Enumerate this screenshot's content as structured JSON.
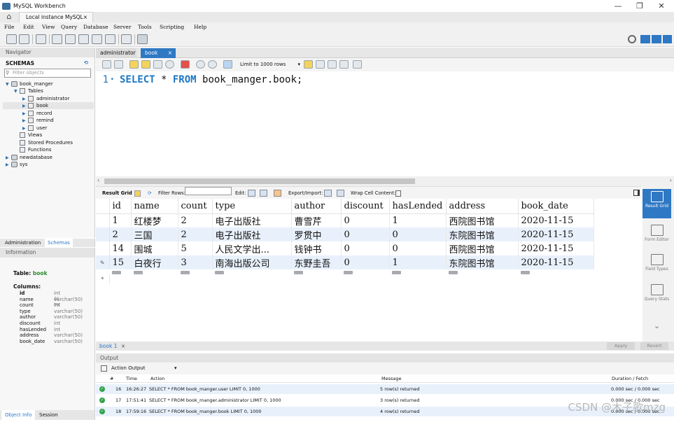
{
  "window": {
    "title": "MySQL Workbench",
    "minimize": "—",
    "maximize": "❐",
    "close": "✕"
  },
  "connection_tab": {
    "label": "Local instance MySQL",
    "close": "×"
  },
  "menu": [
    "File",
    "Edit",
    "View",
    "Query",
    "Database",
    "Server",
    "Tools",
    "Scripting",
    "Help"
  ],
  "navigator": {
    "title": "Navigator",
    "schemas_label": "SCHEMAS",
    "filter_placeholder": "Filter objects",
    "tree": [
      {
        "label": "book_manger"
      },
      {
        "label": "Tables"
      },
      {
        "label": "administrator"
      },
      {
        "label": "book"
      },
      {
        "label": "record"
      },
      {
        "label": "remind"
      },
      {
        "label": "user"
      },
      {
        "label": "Views"
      },
      {
        "label": "Stored Procedures"
      },
      {
        "label": "Functions"
      },
      {
        "label": "newdatabase"
      },
      {
        "label": "sys"
      }
    ],
    "bottom_tabs": [
      "Administration",
      "Schemas"
    ]
  },
  "information": {
    "title": "Information",
    "table_label": "Table:",
    "table_name": "book",
    "columns_label": "Columns:",
    "columns": [
      {
        "name": "id",
        "type": "int AI PK"
      },
      {
        "name": "name",
        "type": "varchar(50)"
      },
      {
        "name": "count",
        "type": "int"
      },
      {
        "name": "type",
        "type": "varchar(50)"
      },
      {
        "name": "author",
        "type": "varchar(50)"
      },
      {
        "name": "discount",
        "type": "int"
      },
      {
        "name": "hasLended",
        "type": "int"
      },
      {
        "name": "address",
        "type": "varchar(50)"
      },
      {
        "name": "book_date",
        "type": "varchar(50)"
      }
    ],
    "bottom_tabs": [
      "Object Info",
      "Session"
    ]
  },
  "editor": {
    "tabs": [
      "administrator",
      "book"
    ],
    "active_tab_close": "×",
    "limit": "Limit to 1000 rows",
    "line_number": "1",
    "sql": {
      "kw1": "SELECT",
      "mid": " * ",
      "kw2": "FROM",
      "rest": " book_manger.book;"
    }
  },
  "result_toolbar": {
    "result_grid": "Result Grid",
    "filter_rows": "Filter Rows:",
    "edit": "Edit:",
    "export_import": "Export/Import:",
    "wrap": "Wrap Cell Content:"
  },
  "result_grid": {
    "columns": [
      "id",
      "name",
      "count",
      "type",
      "author",
      "discount",
      "hasLended",
      "address",
      "book_date"
    ],
    "rows": [
      [
        "1",
        "红楼梦",
        "2",
        "电子出版社",
        "曹雪芹",
        "0",
        "1",
        "西院图书馆",
        "2020-11-15"
      ],
      [
        "2",
        "三国",
        "2",
        "电子出版社",
        "罗贯中",
        "0",
        "0",
        "东院图书馆",
        "2020-11-15"
      ],
      [
        "14",
        "围城",
        "5",
        "人民文学出...",
        "钱钟书",
        "0",
        "0",
        "西院图书馆",
        "2020-11-15"
      ],
      [
        "15",
        "白夜行",
        "3",
        "南海出版公司",
        "东野圭吾",
        "0",
        "1",
        "东院图书馆",
        "2020-11-15"
      ]
    ],
    "new_row_marker": "*",
    "edit_marker": "✎"
  },
  "side_panel": [
    "Result Grid",
    "Form Editor",
    "Field Types",
    "Query Stats"
  ],
  "result_tab": {
    "label": "book 1",
    "close": "×",
    "apply": "Apply",
    "revert": "Revert"
  },
  "output": {
    "title": "Output",
    "selector": "Action Output",
    "headers": [
      "#",
      "Time",
      "Action",
      "Message",
      "Duration / Fetch"
    ],
    "rows": [
      {
        "num": "16",
        "time": "16:26:27",
        "action": "SELECT * FROM book_manger.user LIMIT 0, 1000",
        "message": "5 row(s) returned",
        "duration": "0.000 sec / 0.000 sec"
      },
      {
        "num": "17",
        "time": "17:51:41",
        "action": "SELECT * FROM book_manger.administrator LIMIT 0, 1000",
        "message": "3 row(s) returned",
        "duration": "0.000 sec / 0.000 sec"
      },
      {
        "num": "18",
        "time": "17:59:16",
        "action": "SELECT * FROM book_manger.book LIMIT 0, 1000",
        "message": "4 row(s) returned",
        "duration": "0.000 sec / 0.000 sec"
      }
    ]
  },
  "watermark": "CSDN @木子歌mzg"
}
